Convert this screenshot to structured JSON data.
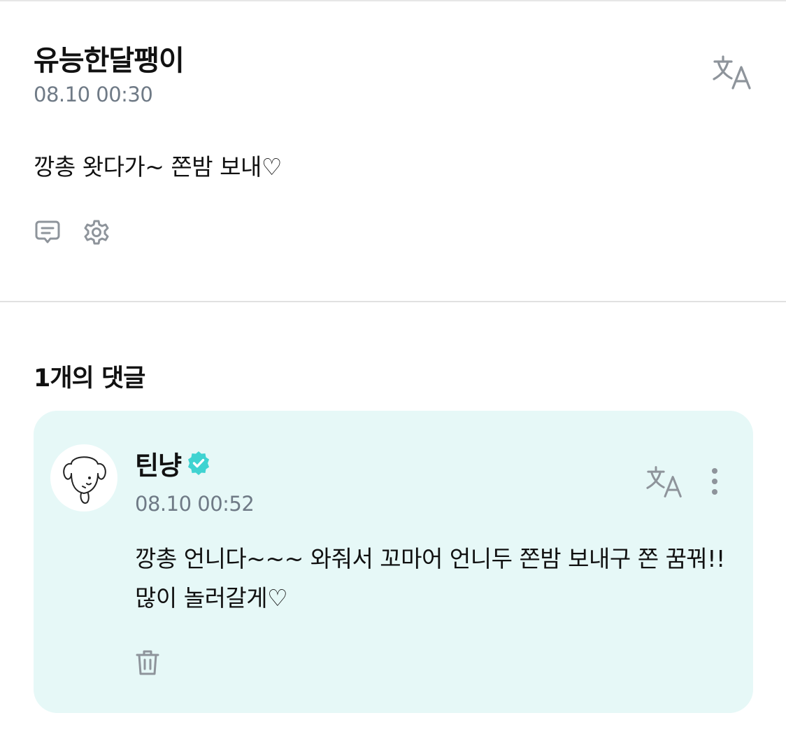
{
  "post": {
    "author": "유능한달팽이",
    "time": "08.10 00:30",
    "body": "깡총 왓다가~ 쫀밤 보내♡"
  },
  "comments": {
    "heading": "1개의 댓글",
    "items": [
      {
        "author": "틴냥",
        "verified": true,
        "time": "08.10 00:52",
        "body": "깡총 언니다~~~ 와줘서 꼬마어 언니두 쫀밤 보내구 쫀 꿈꿔!! 많이 놀러갈게♡"
      }
    ]
  },
  "icons": {
    "translate": "translate-icon",
    "comment": "comment-icon",
    "settings": "gear-icon",
    "verified": "verified-badge-icon",
    "more": "more-vertical-icon",
    "delete": "trash-icon"
  },
  "colors": {
    "card_background": "#e6f8f7",
    "verified_badge": "#3fd3d1",
    "muted_text": "#6f7a86",
    "icon_gray": "#8e949b"
  }
}
